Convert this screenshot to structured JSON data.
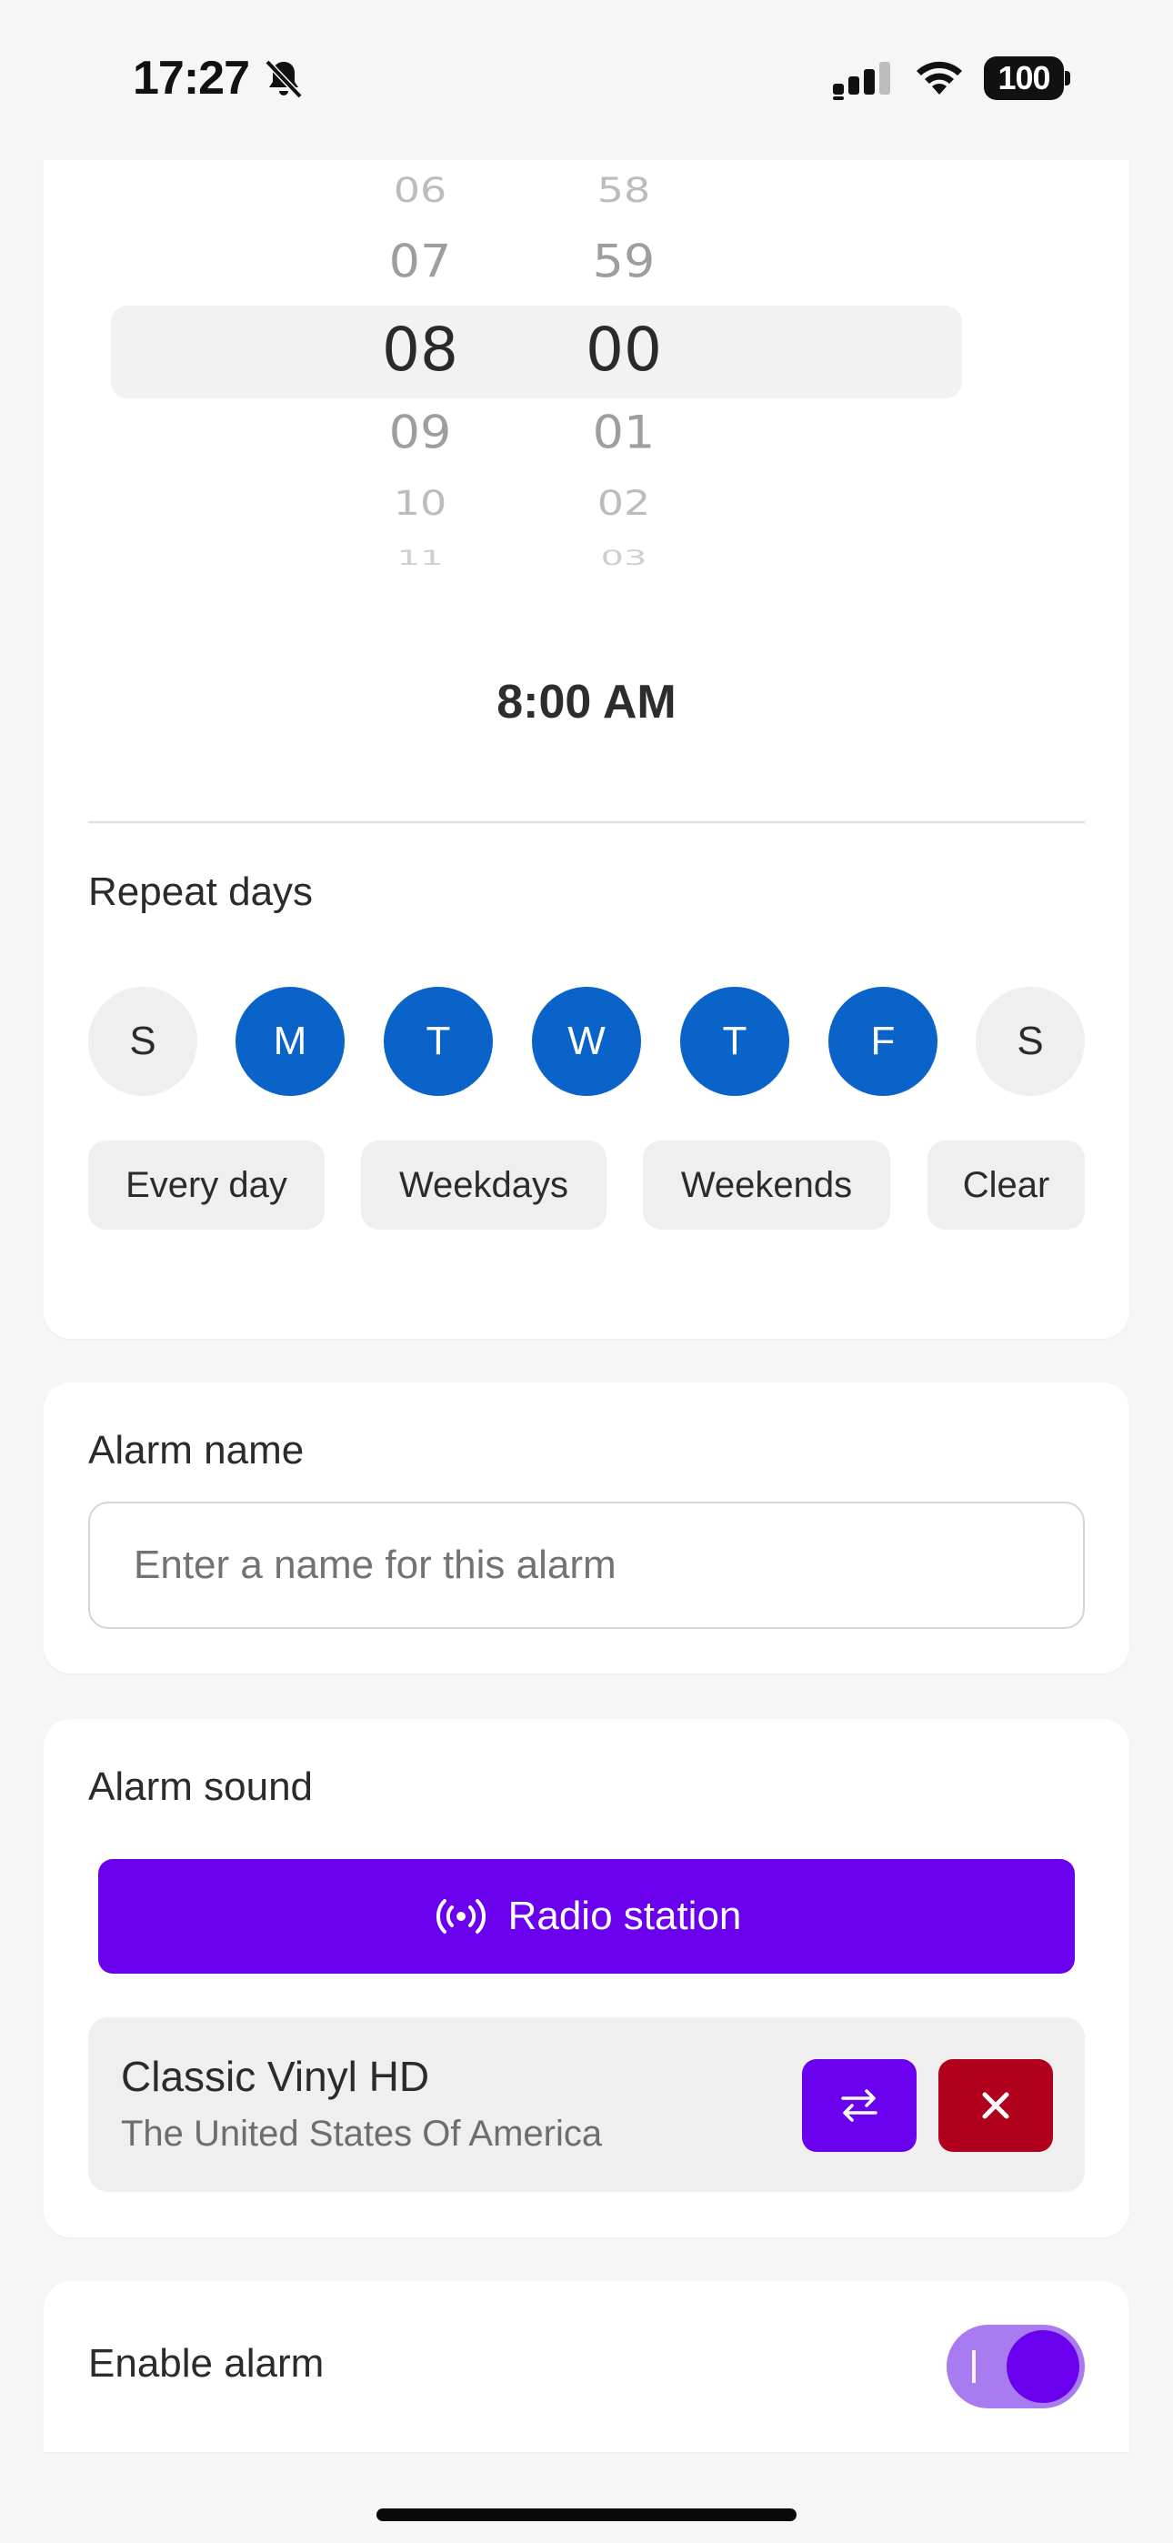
{
  "status_bar": {
    "time": "17:27",
    "battery": "100"
  },
  "picker": {
    "hours": [
      "06",
      "07",
      "08",
      "09",
      "10",
      "11"
    ],
    "minutes": [
      "58",
      "59",
      "00",
      "01",
      "02",
      "03"
    ],
    "selected_hour": "08",
    "selected_minute": "00"
  },
  "time_display": "8:00 AM",
  "repeat": {
    "label": "Repeat days",
    "days": [
      {
        "letter": "S",
        "selected": false
      },
      {
        "letter": "M",
        "selected": true
      },
      {
        "letter": "T",
        "selected": true
      },
      {
        "letter": "W",
        "selected": true
      },
      {
        "letter": "T",
        "selected": true
      },
      {
        "letter": "F",
        "selected": true
      },
      {
        "letter": "S",
        "selected": false
      }
    ],
    "presets": [
      "Every day",
      "Weekdays",
      "Weekends",
      "Clear"
    ]
  },
  "alarm_name": {
    "label": "Alarm name",
    "value": "",
    "placeholder": "Enter a name for this alarm"
  },
  "alarm_sound": {
    "label": "Alarm sound",
    "radio_button_label": "Radio station",
    "station_name": "Classic Vinyl HD",
    "station_country": "The United States Of America"
  },
  "enable": {
    "label": "Enable alarm",
    "enabled": true
  },
  "colors": {
    "accent": "#6a00ee",
    "day_selected": "#0a63c8",
    "danger": "#b0001c"
  }
}
